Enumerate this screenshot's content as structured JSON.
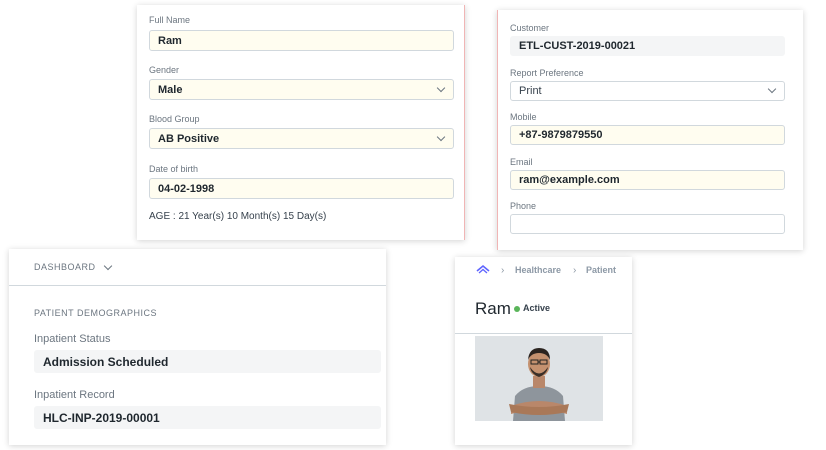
{
  "patient_form": {
    "full_name_label": "Full Name",
    "full_name_value": "Ram",
    "gender_label": "Gender",
    "gender_value": "Male",
    "blood_group_label": "Blood Group",
    "blood_group_value": "AB Positive",
    "dob_label": "Date of birth",
    "dob_value": "04-02-1998",
    "age_text": "AGE : 21 Year(s) 10 Month(s) 15 Day(s)"
  },
  "customer_form": {
    "customer_label": "Customer",
    "customer_value": "ETL-CUST-2019-00021",
    "report_pref_label": "Report Preference",
    "report_pref_value": "Print",
    "mobile_label": "Mobile",
    "mobile_value": "+87-9879879550",
    "email_label": "Email",
    "email_value": "ram@example.com",
    "phone_label": "Phone",
    "phone_value": ""
  },
  "dashboard": {
    "header": "DASHBOARD",
    "section_title": "PATIENT DEMOGRAPHICS",
    "inpatient_status_label": "Inpatient Status",
    "inpatient_status_value": "Admission Scheduled",
    "inpatient_record_label": "Inpatient Record",
    "inpatient_record_value": "HLC-INP-2019-00001"
  },
  "profile": {
    "breadcrumb": [
      "Healthcare",
      "Patient"
    ],
    "name": "Ram",
    "status": "Active",
    "colors": {
      "active": "#5ab55a",
      "logo": "#5e64ff"
    }
  }
}
